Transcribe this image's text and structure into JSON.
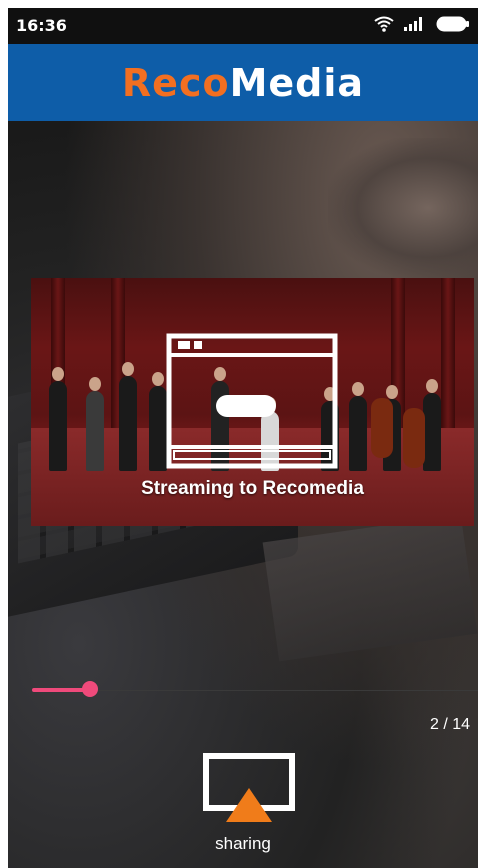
{
  "status_bar": {
    "time": "16:36",
    "icons": [
      "wifi-icon",
      "signal-icon",
      "battery-icon"
    ]
  },
  "header": {
    "logo_part1": "Reco",
    "logo_part2": "Media",
    "colors": {
      "background": "#0e5da8",
      "logo_accent": "#f26f21",
      "logo_main": "#ffffff"
    }
  },
  "video": {
    "overlay_label": "Streaming to Recomedia",
    "overlay_icon": "cast-screen-icon"
  },
  "progress": {
    "fraction": 0.14,
    "color": "#ef4a7b"
  },
  "pager": {
    "text": "2 / 14"
  },
  "share": {
    "label": "sharing",
    "icon": "airplay-icon",
    "icon_accent": "#f07c1a"
  }
}
